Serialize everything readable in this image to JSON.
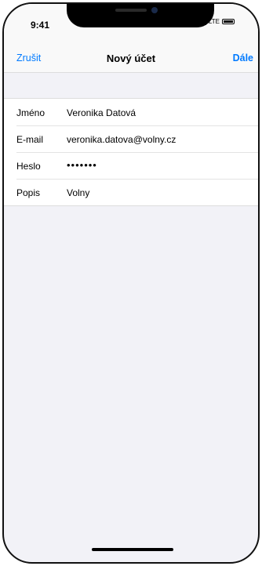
{
  "status_bar": {
    "time": "9:41",
    "network": "LTE"
  },
  "nav": {
    "cancel_label": "Zrušit",
    "title": "Nový účet",
    "next_label": "Dále"
  },
  "form": {
    "rows": [
      {
        "label": "Jméno",
        "value": "Veronika Datová"
      },
      {
        "label": "E-mail",
        "value": "veronika.datova@volny.cz"
      },
      {
        "label": "Heslo",
        "value": "•••••••"
      },
      {
        "label": "Popis",
        "value": "Volny"
      }
    ]
  },
  "colors": {
    "accent": "#007aff",
    "background": "#f2f2f7"
  }
}
